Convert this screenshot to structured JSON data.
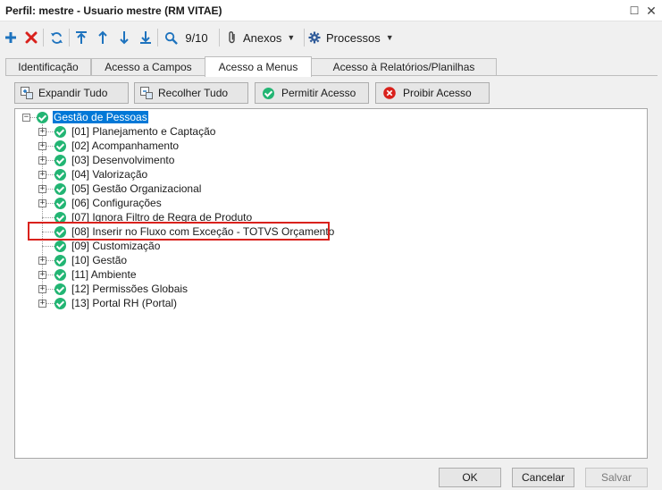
{
  "window": {
    "title": "Perfil: mestre - Usuario mestre (RM VITAE)",
    "maximize_glyph": "☐",
    "close_glyph": "✕"
  },
  "toolbar": {
    "nav_counter": "9/10",
    "attachments_label": "Anexos",
    "processes_label": "Processos"
  },
  "tabs": [
    {
      "label": "Identificação",
      "active": false
    },
    {
      "label": "Acesso a Campos",
      "active": false
    },
    {
      "label": "Acesso a Menus",
      "active": true
    },
    {
      "label": "Acesso à Relatórios/Planilhas",
      "active": false
    }
  ],
  "actions": {
    "expand_all": "Expandir Tudo",
    "collapse_all": "Recolher Tudo",
    "allow_access": "Permitir Acesso",
    "deny_access": "Proibir Acesso"
  },
  "tree": {
    "root": {
      "label": "Gestão de Pessoas",
      "selected": true
    },
    "children": [
      {
        "label": "[01] Planejamento e Captação",
        "expandable": true
      },
      {
        "label": "[02] Acompanhamento",
        "expandable": true
      },
      {
        "label": "[03] Desenvolvimento",
        "expandable": true
      },
      {
        "label": "[04] Valorização",
        "expandable": true
      },
      {
        "label": "[05] Gestão Organizacional",
        "expandable": true
      },
      {
        "label": "[06] Configurações",
        "expandable": true
      },
      {
        "label": "[07] Ignora Filtro de Regra de Produto",
        "expandable": false
      },
      {
        "label": "[08] Inserir no Fluxo com Exceção - TOTVS Orçamento",
        "expandable": false,
        "highlighted": true
      },
      {
        "label": "[09] Customização",
        "expandable": false
      },
      {
        "label": "[10] Gestão",
        "expandable": true
      },
      {
        "label": "[11] Ambiente",
        "expandable": true
      },
      {
        "label": "[12] Permissões Globais",
        "expandable": true
      },
      {
        "label": "[13] Portal RH (Portal)",
        "expandable": true
      }
    ]
  },
  "footer": {
    "ok": "OK",
    "cancel": "Cancelar",
    "save": "Salvar"
  },
  "colors": {
    "accent_blue": "#0078d7",
    "granted_green": "#22b573",
    "delete_red": "#d9211c",
    "highlight_red": "#d9211c"
  }
}
